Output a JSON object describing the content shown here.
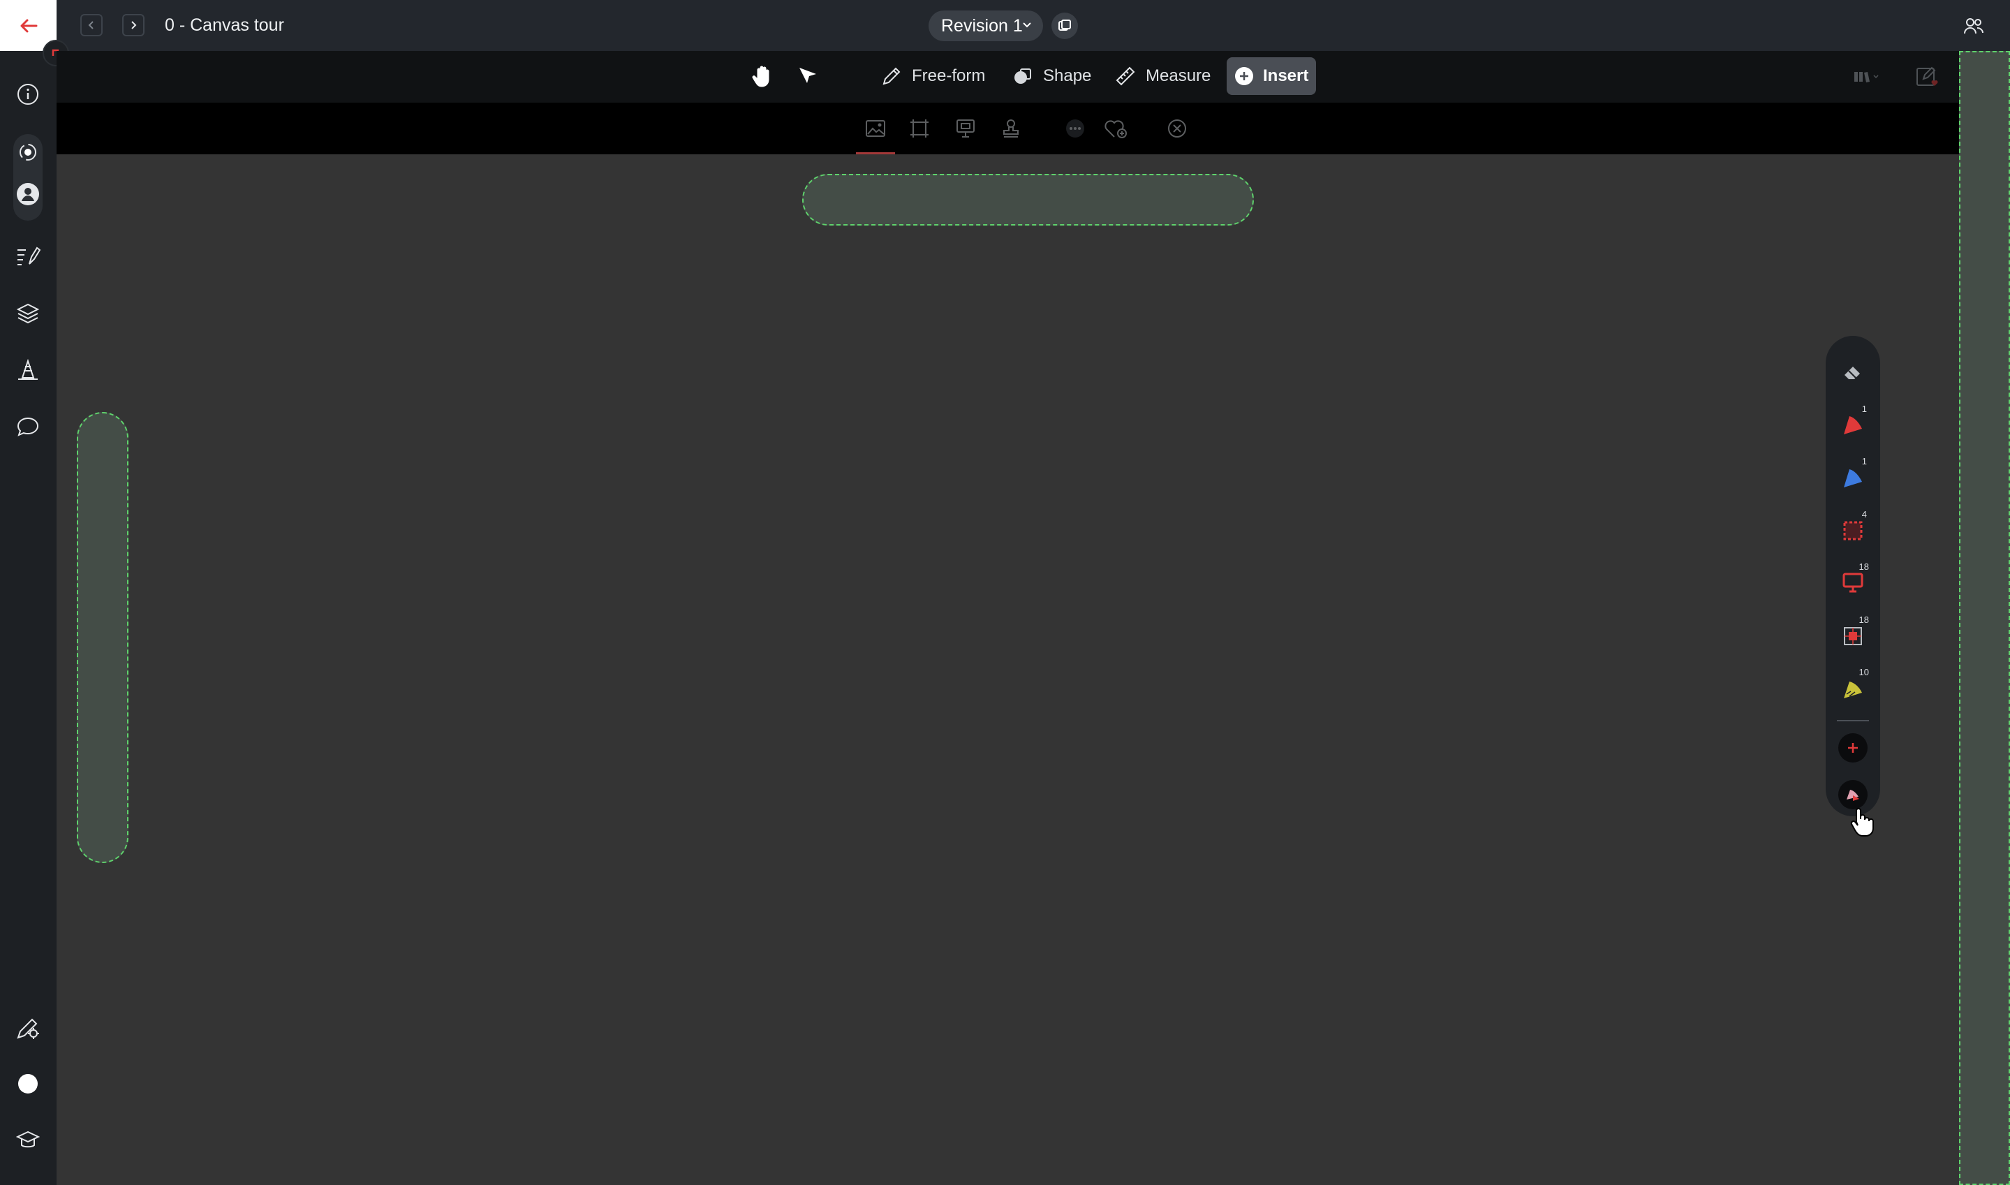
{
  "header": {
    "title": "0 - Canvas tour",
    "revision": "Revision 1",
    "back_icon": "arrow-left-icon",
    "prev_icon": "chevron-left-icon",
    "next_icon": "chevron-right-icon",
    "revision_dropdown_icon": "chevron-down-icon",
    "compare_icon": "compare-revisions-icon",
    "collaborators_icon": "users-icon"
  },
  "toolbar": {
    "pan_icon": "hand-icon",
    "select_icon": "pointer-arrow-icon",
    "freeform_label": "Free-form",
    "shape_label": "Shape",
    "measure_label": "Measure",
    "insert_label": "Insert",
    "library_icon": "library-icon",
    "markup_icon": "edit-favorite-icon",
    "panel_icon": "panel-icon"
  },
  "insert_submenu": {
    "items": [
      "image-icon",
      "frame-icon",
      "screen-icon",
      "stamp-icon",
      "more-icon",
      "favorite-add-icon",
      "close-icon"
    ]
  },
  "sidebar": {
    "items": [
      "info-icon",
      "view-icon",
      "user-icon",
      "markups-list-icon",
      "layers-icon",
      "cone-icon",
      "comment-icon",
      "settings-pen-icon",
      "status-dot-icon",
      "learn-icon"
    ]
  },
  "layer_palette": {
    "items": [
      {
        "icon": "eraser-icon",
        "count": ""
      },
      {
        "icon": "red-sector-icon",
        "count": "1"
      },
      {
        "icon": "blue-sector-icon",
        "count": "1"
      },
      {
        "icon": "red-dashed-rect-icon",
        "count": "4"
      },
      {
        "icon": "red-monitor-icon",
        "count": "18"
      },
      {
        "icon": "red-frame-icon",
        "count": "18"
      },
      {
        "icon": "yellow-sector-icon",
        "count": "10"
      }
    ],
    "add_icon": "plus-icon",
    "settings_icon": "layer-settings-icon"
  },
  "colors": {
    "accent": "#e03a3a",
    "dropzone_border": "#5fd36c",
    "canvas": "#343434"
  }
}
